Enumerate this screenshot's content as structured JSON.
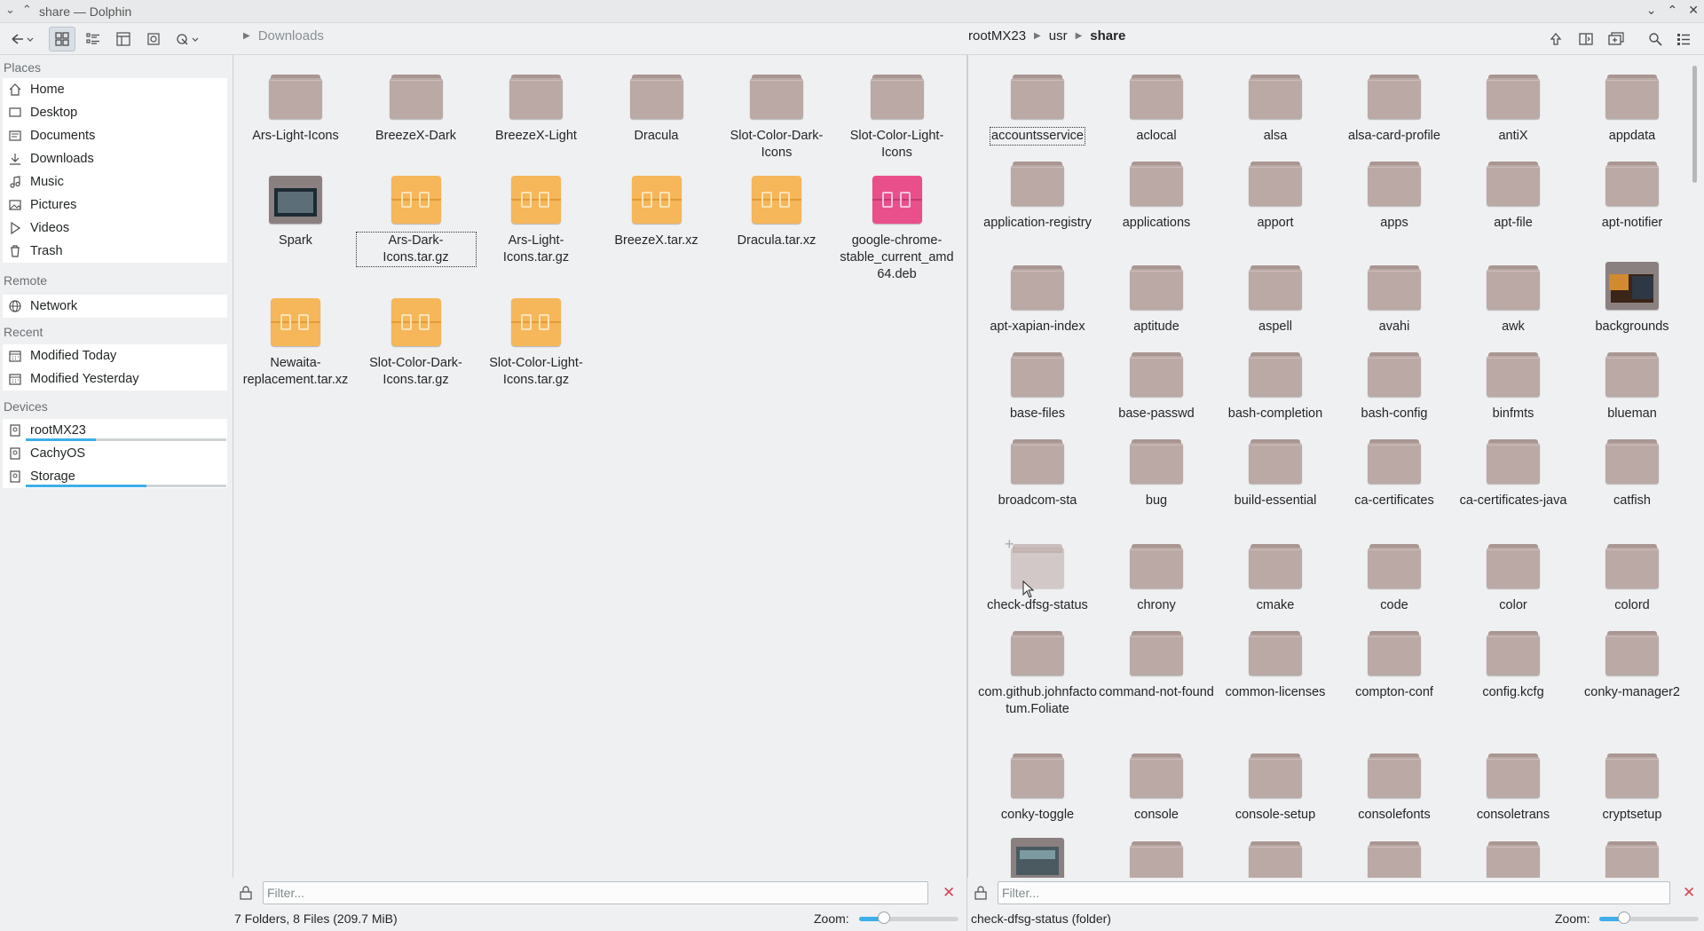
{
  "window": {
    "title": "share — Dolphin",
    "controls": [
      "⌄",
      "⌃",
      "✕"
    ]
  },
  "toolbar": {
    "left_crumbs": [
      "Downloads"
    ],
    "right_crumbs": [
      "rootMX23",
      "usr",
      "share"
    ]
  },
  "sidebar": {
    "sections": {
      "places": "Places",
      "remote": "Remote",
      "recent": "Recent",
      "devices": "Devices"
    },
    "places": [
      "Home",
      "Desktop",
      "Documents",
      "Downloads",
      "Music",
      "Pictures",
      "Videos",
      "Trash"
    ],
    "remote": [
      "Network"
    ],
    "recent": [
      "Modified Today",
      "Modified Yesterday"
    ],
    "devices": [
      {
        "label": "rootMX23",
        "usage": 0.35
      },
      {
        "label": "CachyOS",
        "usage": null
      },
      {
        "label": "Storage",
        "usage": 0.6
      }
    ]
  },
  "left_pane": {
    "items": [
      {
        "label": "Ars-Light-Icons",
        "type": "folder"
      },
      {
        "label": "BreezeX-Dark",
        "type": "folder"
      },
      {
        "label": "BreezeX-Light",
        "type": "folder"
      },
      {
        "label": "Dracula",
        "type": "folder"
      },
      {
        "label": "Slot-Color-Dark-Icons",
        "type": "folder"
      },
      {
        "label": "Slot-Color-Light-Icons",
        "type": "folder"
      },
      {
        "label": "Spark",
        "type": "image-folder"
      },
      {
        "label": "Ars-Dark-Icons.tar.gz",
        "type": "archive"
      },
      {
        "label": "Ars-Light-Icons.tar.gz",
        "type": "archive"
      },
      {
        "label": "BreezeX.tar.xz",
        "type": "archive"
      },
      {
        "label": "Dracula.tar.xz",
        "type": "archive"
      },
      {
        "label": "google-chrome-stable_current_amd64.deb",
        "type": "deb"
      },
      {
        "label": "Newaita-replacement.tar.xz",
        "type": "archive"
      },
      {
        "label": "Slot-Color-Dark-Icons.tar.gz",
        "type": "archive"
      },
      {
        "label": "Slot-Color-Light-Icons.tar.gz",
        "type": "archive"
      }
    ],
    "filter_placeholder": "Filter...",
    "status": "7 Folders, 8 Files (209.7 MiB)",
    "zoom_label": "Zoom:",
    "zoom_level": 0.25
  },
  "right_pane": {
    "items": [
      "accountsservice",
      "aclocal",
      "alsa",
      "alsa-card-profile",
      "antiX",
      "appdata",
      "application-registry",
      "applications",
      "apport",
      "apps",
      "apt-file",
      "apt-notifier",
      "apt-xapian-index",
      "aptitude",
      "aspell",
      "avahi",
      "awk",
      "backgrounds",
      "base-files",
      "base-passwd",
      "bash-completion",
      "bash-config",
      "binfmts",
      "blueman",
      "broadcom-sta",
      "bug",
      "build-essential",
      "ca-certificates",
      "ca-certificates-java",
      "catfish",
      "check-dfsg-status",
      "chrony",
      "cmake",
      "code",
      "color",
      "colord",
      "com.github.johnfactotum.Foliate",
      "command-not-found",
      "common-licenses",
      "compton-conf",
      "config.kcfg",
      "conky-manager2",
      "conky-toggle",
      "console",
      "console-setup",
      "consolefonts",
      "consoletrans",
      "cryptsetup",
      "",
      "",
      "",
      "",
      "",
      ""
    ],
    "filter_placeholder": "Filter...",
    "status": "check-dfsg-status (folder)",
    "zoom_label": "Zoom:",
    "zoom_level": 0.25
  }
}
